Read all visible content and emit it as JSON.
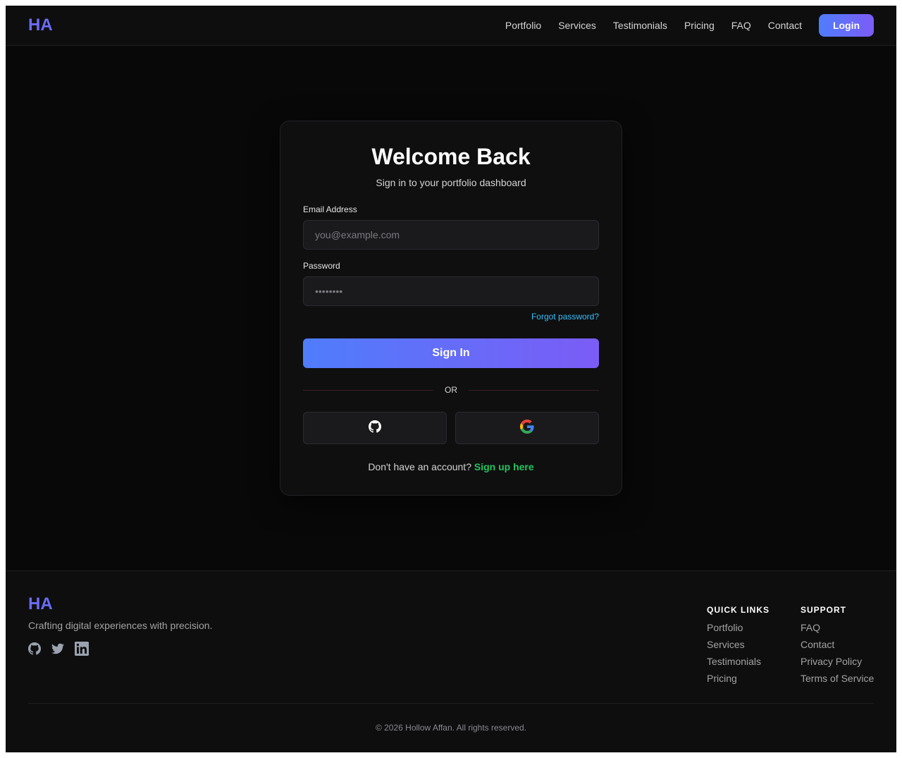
{
  "header": {
    "logo": "HA",
    "nav": [
      "Portfolio",
      "Services",
      "Testimonials",
      "Pricing",
      "FAQ",
      "Contact"
    ],
    "login_label": "Login"
  },
  "card": {
    "title": "Welcome Back",
    "subtitle": "Sign in to your portfolio dashboard",
    "email_label": "Email Address",
    "email_placeholder": "you@example.com",
    "password_label": "Password",
    "password_placeholder": "••••••••",
    "forgot_label": "Forgot password?",
    "signin_label": "Sign In",
    "divider_text": "OR",
    "social_buttons": [
      "github-icon",
      "google-icon"
    ],
    "signup_prompt": "Don't have an account?",
    "signup_link": "Sign up here"
  },
  "footer": {
    "logo": "HA",
    "tagline": "Crafting digital experiences with precision.",
    "social_icons": [
      "github-icon",
      "twitter-icon",
      "linkedin-icon"
    ],
    "quick_links": {
      "heading": "QUICK LINKS",
      "items": [
        "Portfolio",
        "Services",
        "Testimonials",
        "Pricing"
      ]
    },
    "support": {
      "heading": "SUPPORT",
      "items": [
        "FAQ",
        "Contact",
        "Privacy Policy",
        "Terms of Service"
      ]
    },
    "copyright": "© 2026 Hollow Affan. All rights reserved."
  },
  "colors": {
    "brand": "#6b6cf6",
    "gradient_start": "#4f7dfb",
    "gradient_end": "#7c5cf7",
    "link_blue": "#38bdf8",
    "link_green": "#22c55e",
    "background": "#080808"
  }
}
